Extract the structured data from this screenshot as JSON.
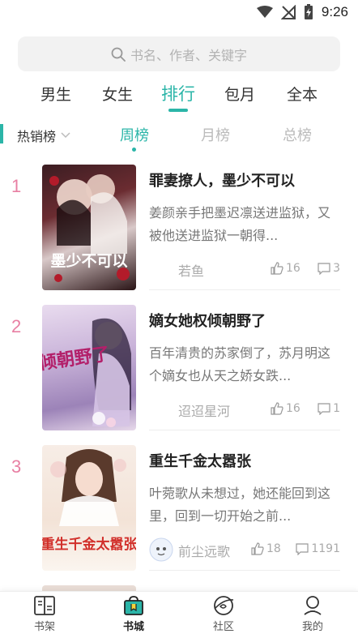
{
  "status_bar": {
    "time": "9:26"
  },
  "search": {
    "placeholder": "书名、作者、关键字"
  },
  "top_tabs": [
    {
      "label": "男生",
      "active": false
    },
    {
      "label": "女生",
      "active": false
    },
    {
      "label": "排行",
      "active": true
    },
    {
      "label": "包月",
      "active": false
    },
    {
      "label": "全本",
      "active": false
    }
  ],
  "ranking": {
    "category": "热销榜",
    "tabs": [
      {
        "label": "周榜",
        "active": true
      },
      {
        "label": "月榜",
        "active": false
      },
      {
        "label": "总榜",
        "active": false
      }
    ]
  },
  "books": [
    {
      "rank": "1",
      "title": "罪妻撩人，墨少不可以",
      "description": "姜颜亲手把墨迟凛送进监狱，又被他送进监狱一朝得...",
      "author": "若鱼",
      "likes": "16",
      "comments": "3",
      "cover_text": "墨少不可以"
    },
    {
      "rank": "2",
      "title": "嫡女她权倾朝野了",
      "description": "百年清贵的苏家倒了，苏月明这个嫡女也从天之娇女跌...",
      "author": "迢迢星河",
      "likes": "16",
      "comments": "1",
      "cover_text": "权倾朝野了"
    },
    {
      "rank": "3",
      "title": "重生千金太嚣张",
      "description": "叶菀歌从未想过，她还能回到这里，回到一切开始之前...",
      "author": "前尘远歌",
      "likes": "18",
      "comments": "1191",
      "cover_text": "重生千金太嚣张"
    }
  ],
  "bottom_nav": [
    {
      "label": "书架",
      "icon": "bookshelf-icon",
      "active": false
    },
    {
      "label": "书城",
      "icon": "bookstore-icon",
      "active": true
    },
    {
      "label": "社区",
      "icon": "community-icon",
      "active": false
    },
    {
      "label": "我的",
      "icon": "profile-icon",
      "active": false
    }
  ],
  "colors": {
    "accent": "#2bb5a8",
    "rank_number": "#e87fa3"
  }
}
